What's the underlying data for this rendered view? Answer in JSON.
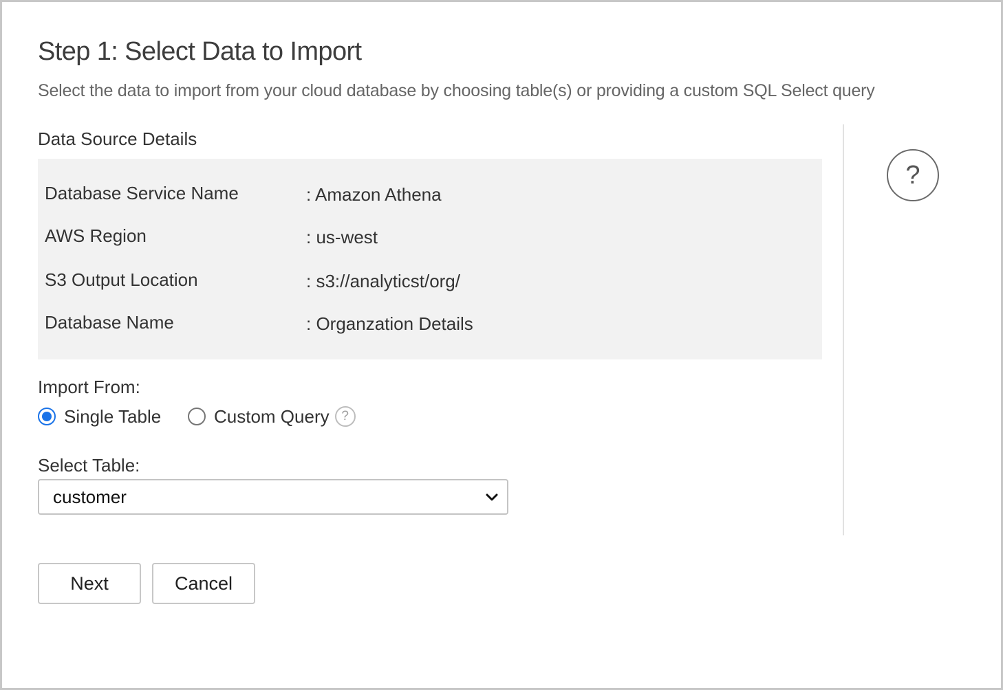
{
  "header": {
    "title": "Step 1: Select Data to Import",
    "subtitle": "Select the data to import from your cloud database by choosing table(s) or providing a custom SQL Select query"
  },
  "data_source": {
    "heading": "Data Source Details",
    "rows": [
      {
        "label": "Database Service Name",
        "value": "Amazon Athena"
      },
      {
        "label": "AWS Region",
        "value": "us-west"
      },
      {
        "label": "S3 Output Location",
        "value": "s3://analyticst/org/"
      },
      {
        "label": "Database Name",
        "value": "Organzation Details"
      }
    ]
  },
  "help": {
    "main_icon": "?",
    "small_icon": "?"
  },
  "import_from": {
    "label": "Import From:",
    "options": [
      {
        "label": "Single Table",
        "checked": true
      },
      {
        "label": "Custom Query",
        "checked": false
      }
    ]
  },
  "select_table": {
    "label": "Select Table:",
    "value": "customer"
  },
  "actions": {
    "next_label": "Next",
    "cancel_label": "Cancel"
  },
  "colors": {
    "accent": "#1a73e8",
    "panel_bg": "#f2f2f2",
    "border": "#c7c7c7"
  },
  "icons": [
    "help-circle-icon",
    "radio-selected-icon",
    "radio-unselected-icon",
    "chevron-down-icon"
  ]
}
